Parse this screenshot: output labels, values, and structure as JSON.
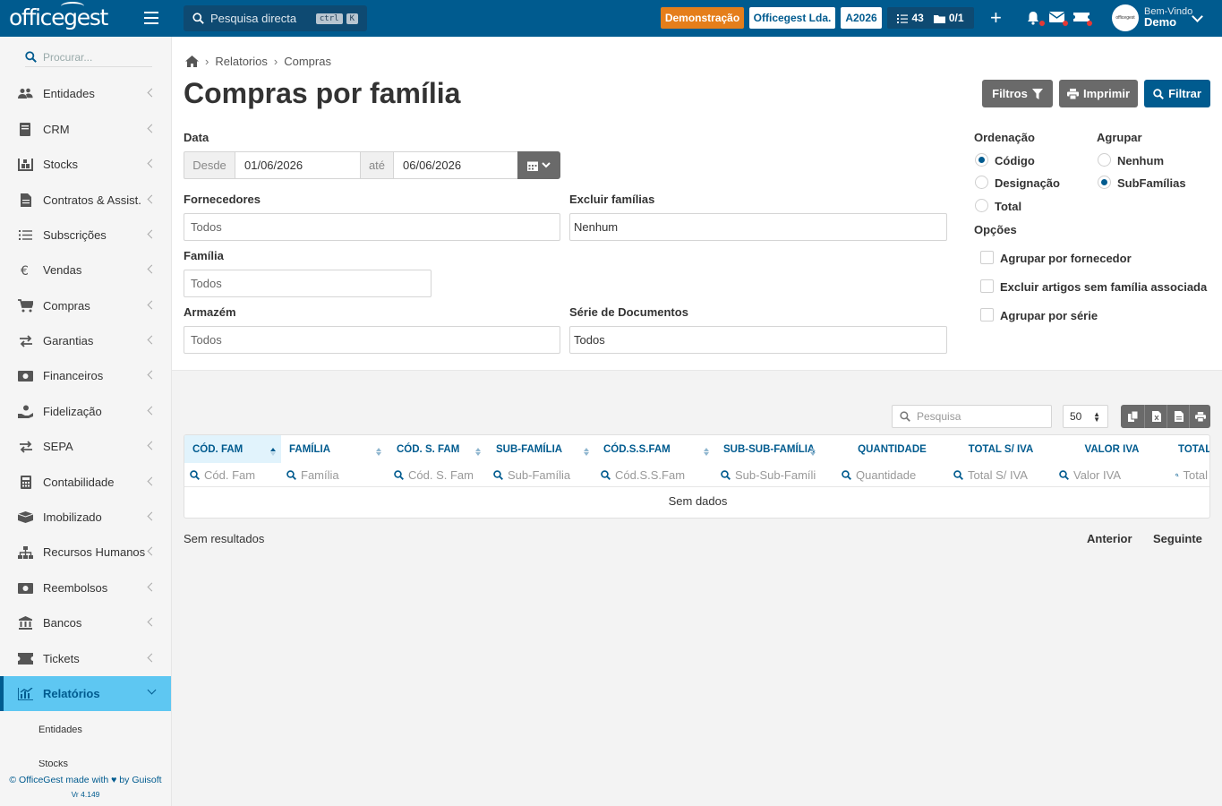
{
  "topbar": {
    "logo": "officegest",
    "search_placeholder": "Pesquisa directa",
    "shortcut_key1": "ctrl",
    "shortcut_key2": "K",
    "badge_demo": "Demonstração",
    "badge_company": "Officegest Lda.",
    "badge_year": "A2026",
    "tasks_count": "43",
    "docs_count": "0/1",
    "welcome": "Bem-Vindo",
    "user": "Demo",
    "avatar_text": "officegest"
  },
  "sidebar": {
    "search_placeholder": "Procurar...",
    "items": [
      {
        "label": "Entidades",
        "icon": "users-icon"
      },
      {
        "label": "CRM",
        "icon": "book-icon"
      },
      {
        "label": "Stocks",
        "icon": "warehouse-icon"
      },
      {
        "label": "Contratos & Assist.",
        "icon": "file-icon"
      },
      {
        "label": "Subscrições",
        "icon": "list-icon"
      },
      {
        "label": "Vendas",
        "icon": "euro-icon"
      },
      {
        "label": "Compras",
        "icon": "cart-icon"
      },
      {
        "label": "Garantias",
        "icon": "exchange-icon"
      },
      {
        "label": "Financeiros",
        "icon": "money-icon"
      },
      {
        "label": "Fidelização",
        "icon": "hand-coin-icon"
      },
      {
        "label": "SEPA",
        "icon": "exchange-icon"
      },
      {
        "label": "Contabilidade",
        "icon": "calculator-icon"
      },
      {
        "label": "Imobilizado",
        "icon": "box-icon"
      },
      {
        "label": "Recursos Humanos",
        "icon": "org-icon"
      },
      {
        "label": "Reembolsos",
        "icon": "money-icon"
      },
      {
        "label": "Bancos",
        "icon": "bank-icon"
      },
      {
        "label": "Tickets",
        "icon": "ticket-icon"
      },
      {
        "label": "Relatórios",
        "icon": "chart-icon"
      }
    ],
    "subitems": [
      "Entidades",
      "Stocks"
    ],
    "footer": "© OfficeGest made with ♥ by Guisoft",
    "version": "Vr 4.149"
  },
  "breadcrumb": [
    "Relatorios",
    "Compras"
  ],
  "page_title": "Compras por família",
  "buttons": {
    "filtros": "Filtros",
    "imprimir": "Imprimir",
    "filtrar": "Filtrar"
  },
  "form": {
    "data_label": "Data",
    "desde": "Desde",
    "date_from": "01/06/2026",
    "ate": "até",
    "date_to": "06/06/2026",
    "fornecedores_label": "Fornecedores",
    "fornecedores_value": "Todos",
    "excluir_label": "Excluir famílias",
    "excluir_value": "Nenhum",
    "familia_label": "Família",
    "familia_value": "Todos",
    "armazem_label": "Armazém",
    "armazem_value": "Todos",
    "serie_label": "Série de Documentos",
    "serie_value": "Todos"
  },
  "ordenacao": {
    "label": "Ordenação",
    "options": [
      "Código",
      "Designação",
      "Total"
    ],
    "selected": "Código"
  },
  "agrupar": {
    "label": "Agrupar",
    "options": [
      "Nenhum",
      "SubFamílias"
    ],
    "selected": "SubFamílias"
  },
  "opcoes": {
    "label": "Opções",
    "options": [
      "Agrupar por fornecedor",
      "Excluir artigos sem família associada",
      "Agrupar por série"
    ]
  },
  "table": {
    "search_placeholder": "Pesquisa",
    "page_size": "50",
    "columns": [
      "CÓD. FAM",
      "FAMÍLIA",
      "CÓD. S. FAM",
      "SUB-FAMÍLIA",
      "CÓD.S.S.FAM",
      "SUB-SUB-FAMÍLIA",
      "QUANTIDADE",
      "TOTAL S/ IVA",
      "VALOR IVA",
      "TOTAL"
    ],
    "filters": [
      "Cód. Fam",
      "Família",
      "Cód. S. Fam",
      "Sub-Família",
      "Cód.S.S.Fam",
      "Sub-Sub-Famíli",
      "Quantidade",
      "Total S/ IVA",
      "Valor IVA",
      "Total"
    ],
    "empty": "Sem dados",
    "no_results": "Sem resultados",
    "prev": "Anterior",
    "next": "Seguinte"
  },
  "colors": {
    "primary": "#005b8f",
    "accent": "#5ec7f2",
    "demo": "#e57e1b",
    "gray_button": "#6a6a6a"
  }
}
